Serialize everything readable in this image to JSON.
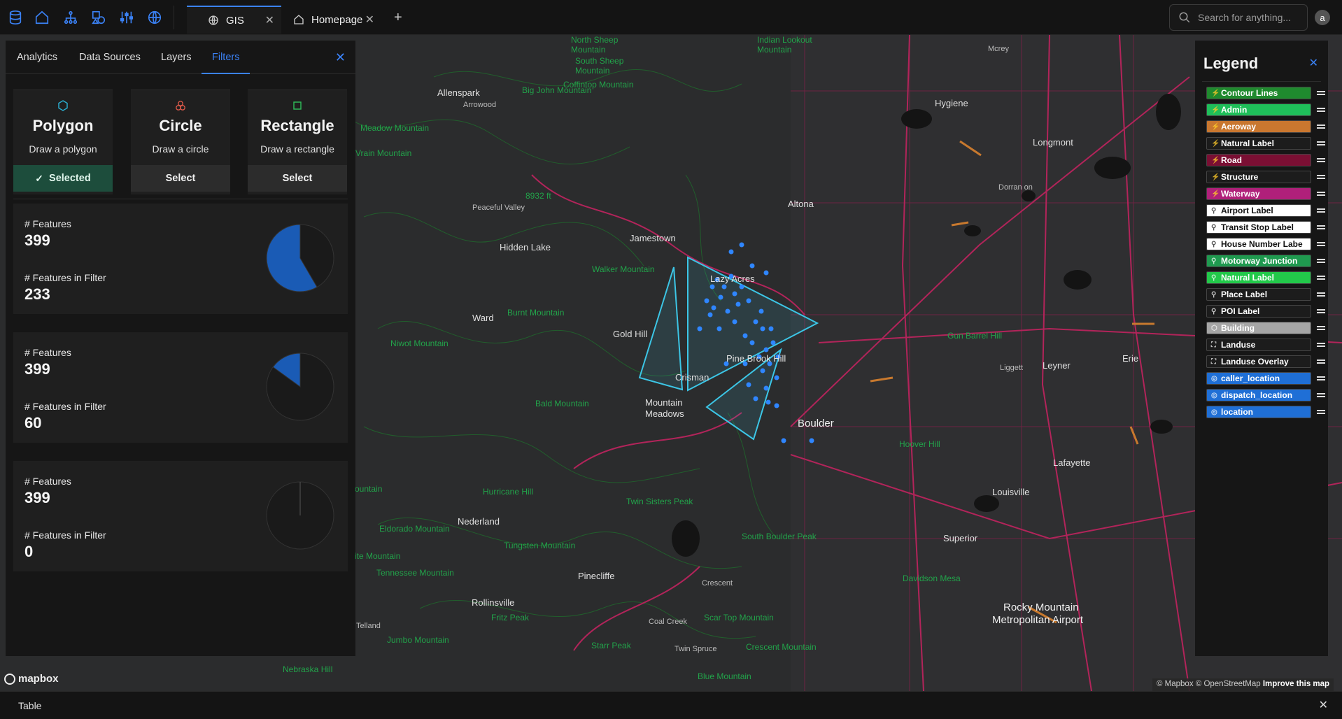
{
  "nav": {
    "icons": [
      "database-icon",
      "home-icon",
      "network-icon",
      "shapes-icon",
      "sliders-icon",
      "globe-icon"
    ]
  },
  "tabs": [
    {
      "label": "GIS",
      "icon": "globe-icon",
      "active": true
    },
    {
      "label": "Homepage",
      "icon": "home-icon",
      "active": false
    }
  ],
  "search": {
    "placeholder": "Search for anything..."
  },
  "user": {
    "initial": "a"
  },
  "panel": {
    "tabs": [
      "Analytics",
      "Data Sources",
      "Layers",
      "Filters"
    ],
    "active_tab": "Filters",
    "tools": [
      {
        "title": "Polygon",
        "desc": "Draw a polygon",
        "button": "Selected",
        "selected": true,
        "icon": "hexagon-icon",
        "color": "#2bb3d6"
      },
      {
        "title": "Circle",
        "desc": "Draw a circle",
        "button": "Select",
        "selected": false,
        "icon": "circles-icon",
        "color": "#e05a4a"
      },
      {
        "title": "Rectangle",
        "desc": "Draw a rectangle",
        "button": "Select",
        "selected": false,
        "icon": "square-icon",
        "color": "#2fbf5a"
      }
    ],
    "stats": [
      {
        "features_label": "# Features",
        "features": "399",
        "filter_label": "# Features in Filter",
        "in_filter": "233",
        "fraction": 0.584
      },
      {
        "features_label": "# Features",
        "features": "399",
        "filter_label": "# Features in Filter",
        "in_filter": "60",
        "fraction": 0.15
      },
      {
        "features_label": "# Features",
        "features": "399",
        "filter_label": "# Features in Filter",
        "in_filter": "0",
        "fraction": 0.0
      }
    ]
  },
  "legend": {
    "title": "Legend",
    "items": [
      {
        "label": "Contour Lines",
        "bg": "#1f8a2e",
        "fg": "#ffffff",
        "icon": "⚡"
      },
      {
        "label": "Admin",
        "bg": "#1fbf5a",
        "fg": "#ffffff",
        "icon": "⚡"
      },
      {
        "label": "Aeroway",
        "bg": "#c9772f",
        "fg": "#ffffff",
        "icon": "⚡"
      },
      {
        "label": "Natural Label",
        "bg": "#1c1c1c",
        "fg": "#ffffff",
        "icon": "⚡"
      },
      {
        "label": "Road",
        "bg": "#7a0f33",
        "fg": "#ffffff",
        "icon": "⚡"
      },
      {
        "label": "Structure",
        "bg": "#1c1c1c",
        "fg": "#ffffff",
        "icon": "⚡"
      },
      {
        "label": "Waterway",
        "bg": "#b0207a",
        "fg": "#ffffff",
        "icon": "⚡"
      },
      {
        "label": "Airport Label",
        "bg": "#ffffff",
        "fg": "#111111",
        "icon": "⚲"
      },
      {
        "label": "Transit Stop Label",
        "bg": "#ffffff",
        "fg": "#111111",
        "icon": "⚲"
      },
      {
        "label": "House Number Labe",
        "bg": "#ffffff",
        "fg": "#111111",
        "icon": "⚲"
      },
      {
        "label": "Motorway Junction",
        "bg": "#1f9a4f",
        "fg": "#ffffff",
        "icon": "⚲"
      },
      {
        "label": "Natural Label",
        "bg": "#22c94a",
        "fg": "#ffffff",
        "icon": "⚲"
      },
      {
        "label": "Place Label",
        "bg": "#1c1c1c",
        "fg": "#ffffff",
        "icon": "⚲"
      },
      {
        "label": "POI Label",
        "bg": "#1c1c1c",
        "fg": "#ffffff",
        "icon": "⚲"
      },
      {
        "label": "Building",
        "bg": "#a6a6a6",
        "fg": "#ffffff",
        "icon": "⬡"
      },
      {
        "label": "Landuse",
        "bg": "#1c1c1c",
        "fg": "#ffffff",
        "icon": "⛶"
      },
      {
        "label": "Landuse Overlay",
        "bg": "#1c1c1c",
        "fg": "#ffffff",
        "icon": "⛶"
      },
      {
        "label": "caller_location",
        "bg": "#1f6fd6",
        "fg": "#ffffff",
        "icon": "◎"
      },
      {
        "label": "dispatch_location",
        "bg": "#1f6fd6",
        "fg": "#ffffff",
        "icon": "◎"
      },
      {
        "label": "location",
        "bg": "#1f6fd6",
        "fg": "#ffffff",
        "icon": "◎"
      }
    ]
  },
  "map": {
    "labels": [
      {
        "text": "Longmont",
        "kind": "town"
      },
      {
        "text": "Boulder",
        "kind": "big"
      },
      {
        "text": "Lafayette",
        "kind": "town"
      },
      {
        "text": "Louisville",
        "kind": "town"
      },
      {
        "text": "Superior",
        "kind": "town"
      },
      {
        "text": "Erie",
        "kind": "town"
      },
      {
        "text": "Leyner",
        "kind": "town"
      },
      {
        "text": "Hygiene",
        "kind": "town"
      },
      {
        "text": "Altona",
        "kind": "town"
      },
      {
        "text": "Jamestown",
        "kind": "town"
      },
      {
        "text": "Hidden Lake",
        "kind": "town"
      },
      {
        "text": "Ward",
        "kind": "town"
      },
      {
        "text": "Gold Hill",
        "kind": "town"
      },
      {
        "text": "Crisman",
        "kind": "town"
      },
      {
        "text": "Lazy Acres",
        "kind": "town"
      },
      {
        "text": "Pine Brook Hill",
        "kind": "town"
      },
      {
        "text": "Mountain",
        "kind": "town"
      },
      {
        "text": "Meadows",
        "kind": "town"
      },
      {
        "text": "Nederland",
        "kind": "town"
      },
      {
        "text": "Pinecliffe",
        "kind": "town"
      },
      {
        "text": "Rollinsville",
        "kind": "town"
      },
      {
        "text": "Allenspark",
        "kind": "town"
      },
      {
        "text": "Rocky Mountain",
        "kind": "big"
      },
      {
        "text": "Metropolitan Airport",
        "kind": "big"
      },
      {
        "text": "Peaceful Valley",
        "kind": "dim"
      },
      {
        "text": "Arrowood",
        "kind": "dim"
      },
      {
        "text": "Liggett",
        "kind": "dim"
      },
      {
        "text": "Dorran on",
        "kind": "dim"
      },
      {
        "text": "Crescent",
        "kind": "dim"
      },
      {
        "text": "Coal Creek",
        "kind": "dim"
      },
      {
        "text": "Twin Spruce",
        "kind": "dim"
      },
      {
        "text": "Telland",
        "kind": "dim"
      },
      {
        "text": "Mcrey",
        "kind": "dim"
      },
      {
        "text": "North Sheep",
        "kind": "green"
      },
      {
        "text": "Mountain",
        "kind": "green"
      },
      {
        "text": "South Sheep",
        "kind": "green"
      },
      {
        "text": "Mountain",
        "kind": "green"
      },
      {
        "text": "Indian Lookout",
        "kind": "green"
      },
      {
        "text": "Mountain",
        "kind": "green"
      },
      {
        "text": "Big John Mountain",
        "kind": "green"
      },
      {
        "text": "Coffintop Mountain",
        "kind": "green"
      },
      {
        "text": "Meadow Mountain",
        "kind": "green"
      },
      {
        "text": "Vrain Mountain",
        "kind": "green"
      },
      {
        "text": "8932 ft",
        "kind": "green"
      },
      {
        "text": "Walker Mountain",
        "kind": "green"
      },
      {
        "text": "Burnt Mountain",
        "kind": "green"
      },
      {
        "text": "Niwot Mountain",
        "kind": "green"
      },
      {
        "text": "Bald Mountain",
        "kind": "green"
      },
      {
        "text": "Gun Barrel Hill",
        "kind": "green"
      },
      {
        "text": "Hoover Hill",
        "kind": "green"
      },
      {
        "text": "Twin Sisters Peak",
        "kind": "green"
      },
      {
        "text": "Hurricane Hill",
        "kind": "green"
      },
      {
        "text": "Eldorado Mountain",
        "kind": "green"
      },
      {
        "text": "Tungsten Mountain",
        "kind": "green"
      },
      {
        "text": "Tennessee Mountain",
        "kind": "green"
      },
      {
        "text": "South Boulder Peak",
        "kind": "green"
      },
      {
        "text": "Davidson Mesa",
        "kind": "green"
      },
      {
        "text": "Scar Top Mountain",
        "kind": "green"
      },
      {
        "text": "Crescent Mountain",
        "kind": "green"
      },
      {
        "text": "Starr Peak",
        "kind": "green"
      },
      {
        "text": "Fritz Peak",
        "kind": "green"
      },
      {
        "text": "Jumbo Mountain",
        "kind": "green"
      },
      {
        "text": "Nebraska Hill",
        "kind": "green"
      },
      {
        "text": "Blue Mountain",
        "kind": "green"
      },
      {
        "text": "ountain",
        "kind": "green"
      },
      {
        "text": "ite Mountain",
        "kind": "green"
      }
    ]
  },
  "mapbox": {
    "logo": "mapbox",
    "attribution": "© Mapbox © OpenStreetMap",
    "improve": "Improve this map"
  },
  "drawer": {
    "title": "Table"
  }
}
